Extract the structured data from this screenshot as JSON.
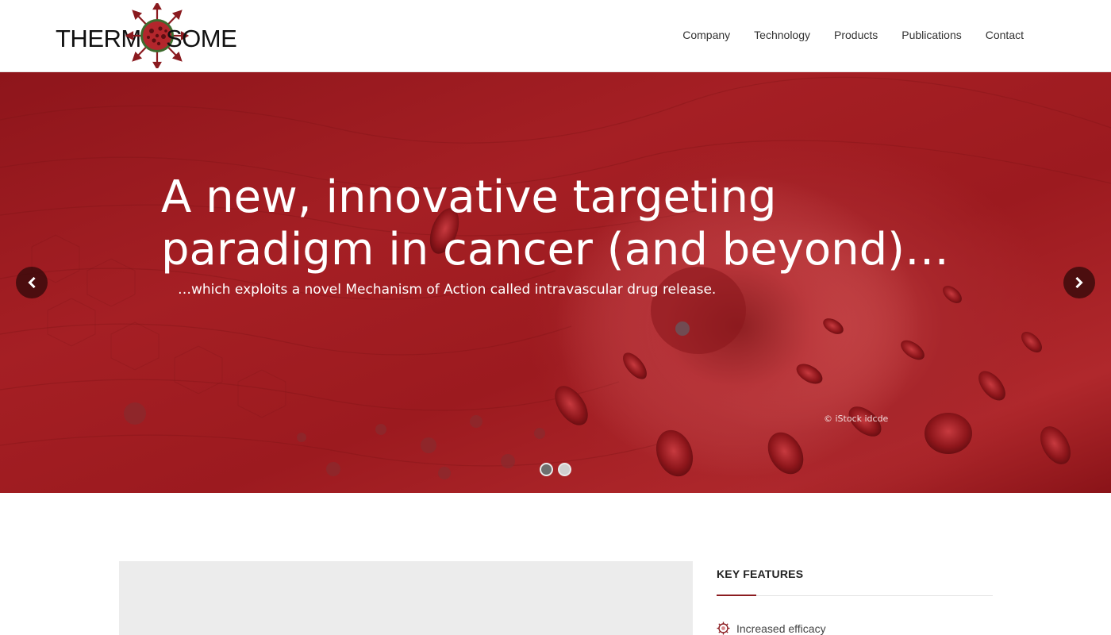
{
  "header": {
    "logo": {
      "left_text": "THERM",
      "right_text": "SOME"
    },
    "nav": [
      {
        "label": "Company"
      },
      {
        "label": "Technology"
      },
      {
        "label": "Products"
      },
      {
        "label": "Publications"
      },
      {
        "label": "Contact"
      }
    ]
  },
  "hero": {
    "title": "A new, innovative targeting paradigm in cancer (and beyond)…",
    "subtitle": "…which exploits a novel Mechanism of Action called intravascular drug release.",
    "credit": "© iStock idcde",
    "prev_icon": "chevron-left-icon",
    "next_icon": "chevron-right-icon",
    "slides_total": 2,
    "active_slide": 1
  },
  "features": {
    "title": "KEY FEATURES",
    "items": [
      {
        "label": "Increased efficacy",
        "icon": "virus-bullet-icon"
      }
    ]
  },
  "colors": {
    "accent": "#8b1c20",
    "hero_red": "#a51f24",
    "arrow_bg": "#3c0a0c"
  }
}
